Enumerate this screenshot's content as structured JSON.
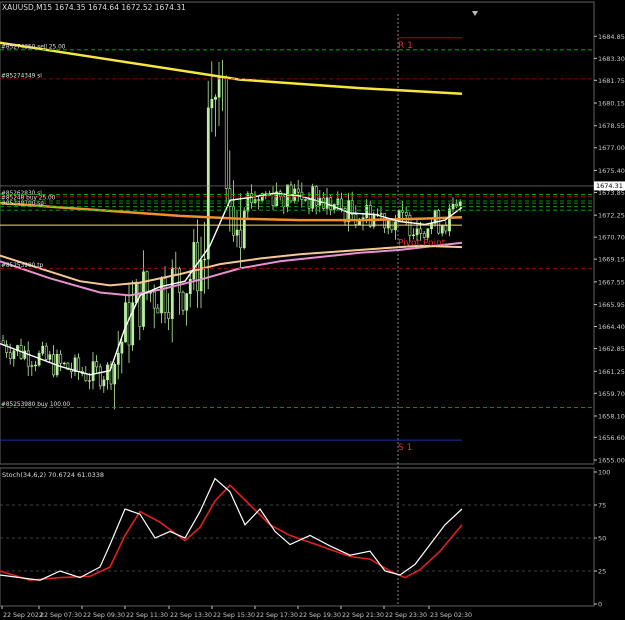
{
  "symbol_header": "XAUUSD,M15  1674.35 1674.64 1672.52 1674.31",
  "price_axis": {
    "ticks": [
      "1684.85",
      "1683.30",
      "1681.75",
      "1680.15",
      "1678.55",
      "1677.00",
      "1675.40",
      "1673.85",
      "1672.25",
      "1670.70",
      "1669.15",
      "1667.55",
      "1665.95",
      "1664.40",
      "1662.85",
      "1661.25",
      "1659.70",
      "1658.10",
      "1656.60",
      "1655.00"
    ],
    "tick_values": [
      1684.85,
      1683.3,
      1681.75,
      1680.15,
      1678.55,
      1677.0,
      1675.4,
      1673.85,
      1672.25,
      1670.7,
      1669.15,
      1667.55,
      1665.95,
      1664.4,
      1662.85,
      1661.25,
      1659.7,
      1658.1,
      1656.6,
      1655.0
    ],
    "current_price": "1674.31",
    "range": [
      1655.0,
      1686.0
    ]
  },
  "pivots": {
    "r1": {
      "label": "R 1",
      "value": 1685.45
    },
    "s1": {
      "label": "S 1",
      "value": 1656.4
    },
    "pivot": {
      "label": "Pivot Point",
      "value": 1670.95
    }
  },
  "order_labels": [
    {
      "text": "#85274350 sell 25.00",
      "value": 1683.9
    },
    {
      "text": "#85274349 sl",
      "value": 1681.85
    },
    {
      "text": "#85262830 sl",
      "value": 1673.55
    },
    {
      "text": "#85248 buy 25.00",
      "value": 1673.25
    },
    {
      "text": "#85248700 sp",
      "value": 1672.85
    },
    {
      "text": "#85253980 tp",
      "value": 1668.5
    },
    {
      "text": "#85253980 buy 100.00",
      "value": 1658.7
    }
  ],
  "lines": {
    "ma_yellow": {
      "color": "#f5e642",
      "points": [
        [
          0,
          1684.4
        ],
        [
          120,
          1683.1
        ],
        [
          240,
          1681.8
        ],
        [
          360,
          1681.2
        ],
        [
          462,
          1680.8
        ]
      ]
    },
    "ma_orange": {
      "color": "#f0902a",
      "points": [
        [
          0,
          1673.1
        ],
        [
          60,
          1672.8
        ],
        [
          120,
          1672.5
        ],
        [
          180,
          1672.2
        ],
        [
          240,
          1672.0
        ],
        [
          300,
          1671.9
        ],
        [
          360,
          1671.9
        ],
        [
          420,
          1672.0
        ],
        [
          462,
          1672.1
        ]
      ]
    },
    "ma_pink": {
      "color": "#e890d0",
      "points": [
        [
          0,
          1669.0
        ],
        [
          50,
          1667.8
        ],
        [
          100,
          1666.8
        ],
        [
          130,
          1666.6
        ],
        [
          160,
          1667.0
        ],
        [
          200,
          1667.7
        ],
        [
          240,
          1668.5
        ],
        [
          280,
          1669.0
        ],
        [
          320,
          1669.3
        ],
        [
          360,
          1669.6
        ],
        [
          400,
          1669.8
        ],
        [
          462,
          1670.3
        ]
      ]
    },
    "ma_peach": {
      "color": "#f5c896",
      "points": [
        [
          0,
          1669.4
        ],
        [
          40,
          1668.5
        ],
        [
          80,
          1667.6
        ],
        [
          110,
          1667.3
        ],
        [
          140,
          1667.5
        ],
        [
          180,
          1668.1
        ],
        [
          220,
          1668.8
        ],
        [
          260,
          1669.2
        ],
        [
          300,
          1669.5
        ],
        [
          340,
          1669.7
        ],
        [
          380,
          1669.9
        ],
        [
          420,
          1670.1
        ],
        [
          462,
          1670.0
        ]
      ]
    },
    "ma_white": {
      "color": "#ffffff",
      "points": [
        [
          0,
          1663.2
        ],
        [
          30,
          1662.4
        ],
        [
          60,
          1661.6
        ],
        [
          90,
          1661.0
        ],
        [
          110,
          1661.3
        ],
        [
          125,
          1664.3
        ],
        [
          140,
          1666.6
        ],
        [
          160,
          1667.2
        ],
        [
          185,
          1667.6
        ],
        [
          210,
          1670.1
        ],
        [
          230,
          1673.3
        ],
        [
          250,
          1673.5
        ],
        [
          275,
          1673.8
        ],
        [
          300,
          1673.6
        ],
        [
          325,
          1673.1
        ],
        [
          350,
          1672.4
        ],
        [
          375,
          1672.3
        ],
        [
          400,
          1671.8
        ],
        [
          425,
          1671.6
        ],
        [
          445,
          1671.9
        ],
        [
          462,
          1672.8
        ]
      ]
    }
  },
  "stochastic": {
    "label": "Stoch(34,6,2) 70.6724 61.0338",
    "ticks": [
      "100",
      "75",
      "50",
      "25",
      "0"
    ],
    "tick_values": [
      100,
      75,
      50,
      25,
      0
    ],
    "main_color": "#ffffff",
    "signal_color": "#e02020",
    "main": [
      [
        0,
        22
      ],
      [
        20,
        20
      ],
      [
        40,
        18
      ],
      [
        60,
        25
      ],
      [
        80,
        20
      ],
      [
        100,
        28
      ],
      [
        110,
        45
      ],
      [
        125,
        72
      ],
      [
        140,
        68
      ],
      [
        155,
        50
      ],
      [
        170,
        55
      ],
      [
        185,
        50
      ],
      [
        200,
        70
      ],
      [
        215,
        95
      ],
      [
        230,
        85
      ],
      [
        245,
        60
      ],
      [
        260,
        72
      ],
      [
        275,
        55
      ],
      [
        290,
        45
      ],
      [
        310,
        52
      ],
      [
        330,
        44
      ],
      [
        350,
        37
      ],
      [
        370,
        40
      ],
      [
        385,
        25
      ],
      [
        400,
        22
      ],
      [
        415,
        30
      ],
      [
        430,
        45
      ],
      [
        445,
        60
      ],
      [
        462,
        72
      ]
    ],
    "signal": [
      [
        0,
        25
      ],
      [
        30,
        18
      ],
      [
        60,
        20
      ],
      [
        90,
        21
      ],
      [
        110,
        28
      ],
      [
        125,
        52
      ],
      [
        140,
        70
      ],
      [
        160,
        62
      ],
      [
        185,
        48
      ],
      [
        200,
        58
      ],
      [
        215,
        78
      ],
      [
        230,
        90
      ],
      [
        250,
        75
      ],
      [
        270,
        60
      ],
      [
        290,
        52
      ],
      [
        320,
        44
      ],
      [
        350,
        36
      ],
      [
        370,
        34
      ],
      [
        390,
        25
      ],
      [
        405,
        20
      ],
      [
        420,
        26
      ],
      [
        440,
        40
      ],
      [
        462,
        60
      ]
    ]
  },
  "time_axis": {
    "labels": [
      "22 Sep 2022",
      "22 Sep 07:30",
      "22 Sep 09:30",
      "22 Sep 11:30",
      "22 Sep 13:30",
      "22 Sep 15:30",
      "22 Sep 17:30",
      "22 Sep 19:30",
      "22 Sep 21:30",
      "22 Sep 23:30",
      "23 Sep 02:30"
    ]
  },
  "colors": {
    "background": "#000000",
    "candle": "#b8f0a0",
    "grid": "#555555",
    "order_line": "#00c000",
    "tp_line": "#c00000",
    "s1_line": "#2030a0",
    "pivot_text": "#e03030",
    "axis_text": "#c8c8c8"
  }
}
